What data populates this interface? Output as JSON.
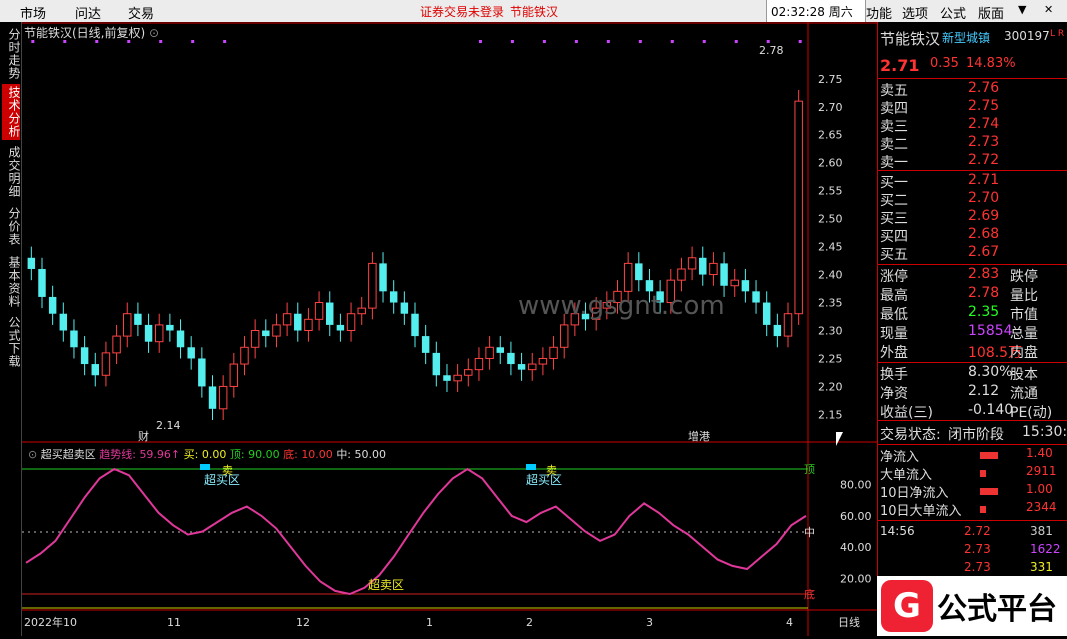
{
  "topbar": {
    "menu": [
      "市场",
      "问达",
      "交易"
    ],
    "alert": "证券交易未登录",
    "alert_stock": "节能铁汉",
    "time": "02:32:28",
    "weekday": "周六",
    "right_menu": [
      "功能",
      "选项",
      "公式",
      "版面"
    ]
  },
  "leftnav": [
    "分时走势",
    "技术分析",
    "成交明细",
    "分价表",
    "基本资料",
    "公式下载"
  ],
  "chart": {
    "title": "节能铁汉(日线,前复权)",
    "price_labels": [
      "2.75",
      "2.70",
      "2.65",
      "2.60",
      "2.55",
      "2.50",
      "2.45",
      "2.40",
      "2.35",
      "2.30",
      "2.25",
      "2.20",
      "2.15"
    ],
    "high_mark": "2.78",
    "low_mark": "2.14",
    "marker_cai": "财",
    "marker_zenggang": "增港",
    "watermark": "www.gsgnt.com",
    "date_labels": [
      "2022年10",
      "11",
      "12",
      "1",
      "2",
      "3",
      "4"
    ],
    "date_right": "日线"
  },
  "indicator": {
    "name": "超买超卖区",
    "trend_label": "趋势线:",
    "trend_value": "59.96↑",
    "buy_label": "买:",
    "buy_value": "0.00",
    "top_label": "顶:",
    "top_value": "90.00",
    "bottom_label": "底:",
    "bottom_value": "10.00",
    "mid_label": "中:",
    "mid_value": "50.00",
    "zone_overbought": "超买区",
    "zone_oversold": "超卖区",
    "sell_tag": "卖",
    "axis_labels": [
      "80.00",
      "60.00",
      "40.00",
      "20.00"
    ],
    "line_top": "顶",
    "line_mid": "中",
    "line_bottom": "底"
  },
  "quote": {
    "name": "节能铁汉",
    "concept": "新型城镇",
    "code": "300197",
    "flags": "L R",
    "price": "2.71",
    "change": "0.35",
    "pct": "14.83%",
    "asks": [
      {
        "label": "卖五",
        "price": "2.76"
      },
      {
        "label": "卖四",
        "price": "2.75"
      },
      {
        "label": "卖三",
        "price": "2.74"
      },
      {
        "label": "卖二",
        "price": "2.73"
      },
      {
        "label": "卖一",
        "price": "2.72"
      }
    ],
    "bids": [
      {
        "label": "买一",
        "price": "2.71"
      },
      {
        "label": "买二",
        "price": "2.70"
      },
      {
        "label": "买三",
        "price": "2.69"
      },
      {
        "label": "买四",
        "price": "2.68"
      },
      {
        "label": "买五",
        "price": "2.67"
      }
    ],
    "stats": [
      {
        "l": "涨停",
        "v": "2.83",
        "l2": "跌停"
      },
      {
        "l": "最高",
        "v": "2.78",
        "l2": "量比"
      },
      {
        "l": "最低",
        "v": "2.35",
        "l2": "市值",
        "green": true
      },
      {
        "l": "现量",
        "v": "15854",
        "l2": "总量",
        "purple": true
      },
      {
        "l": "外盘",
        "v": "108.5万",
        "l2": "内盘"
      }
    ],
    "stats2": [
      {
        "l": "换手",
        "v": "8.30%",
        "l2": "股本"
      },
      {
        "l": "净资",
        "v": "2.12",
        "l2": "流通"
      },
      {
        "l": "收益(三)",
        "v": "-0.140",
        "l2": "PE(动)"
      }
    ],
    "status_label": "交易状态:",
    "status_value": "闭市阶段",
    "status_time": "15:30:",
    "flows": [
      {
        "l": "净流入",
        "v": "1.40"
      },
      {
        "l": "大单流入",
        "v": "2911"
      },
      {
        "l": "10日净流入",
        "v": "1.00"
      },
      {
        "l": "10日大单流入",
        "v": "2344"
      }
    ],
    "ticks": [
      {
        "t": "14:56",
        "p": "2.72",
        "v": "381"
      },
      {
        "t": "",
        "p": "2.73",
        "v": "1622"
      },
      {
        "t": "",
        "p": "2.73",
        "v": "331"
      }
    ]
  },
  "logo": {
    "mark": "G",
    "text": "公式平台"
  },
  "chart_data": {
    "type": "candlestick",
    "series_close": [
      2.41,
      2.36,
      2.33,
      2.3,
      2.27,
      2.24,
      2.22,
      2.26,
      2.29,
      2.33,
      2.31,
      2.28,
      2.31,
      2.3,
      2.27,
      2.25,
      2.2,
      2.16,
      2.2,
      2.24,
      2.27,
      2.3,
      2.29,
      2.31,
      2.33,
      2.3,
      2.32,
      2.35,
      2.31,
      2.3,
      2.33,
      2.34,
      2.42,
      2.37,
      2.35,
      2.33,
      2.29,
      2.26,
      2.22,
      2.21,
      2.22,
      2.23,
      2.25,
      2.27,
      2.26,
      2.24,
      2.23,
      2.24,
      2.25,
      2.27,
      2.31,
      2.33,
      2.32,
      2.34,
      2.35,
      2.37,
      2.42,
      2.39,
      2.37,
      2.35,
      2.39,
      2.41,
      2.43,
      2.4,
      2.42,
      2.38,
      2.39,
      2.37,
      2.35,
      2.31,
      2.29,
      2.33,
      2.71
    ],
    "ylim": [
      2.14,
      2.78
    ],
    "indicator_values": [
      30,
      36,
      44,
      58,
      72,
      84,
      90,
      86,
      74,
      62,
      54,
      48,
      50,
      56,
      62,
      66,
      60,
      52,
      40,
      28,
      18,
      12,
      10,
      14,
      22,
      34,
      48,
      62,
      74,
      84,
      90,
      84,
      72,
      60,
      56,
      62,
      66,
      58,
      50,
      44,
      48,
      60,
      68,
      62,
      54,
      48,
      40,
      32,
      28,
      26,
      34,
      42,
      54,
      60
    ],
    "indicator_ylim": [
      0,
      100
    ]
  }
}
